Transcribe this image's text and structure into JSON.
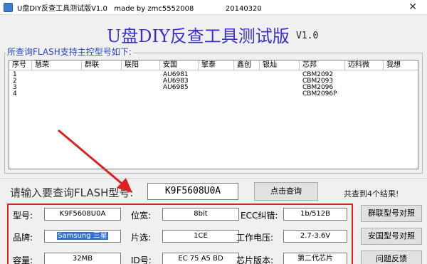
{
  "window": {
    "title": "U盘DIY反查工具测试版V1.0   made by zmc5552008              20140320",
    "close_glyph": "✕"
  },
  "banner": {
    "title": "U盘DIY反查工具测试版",
    "version": "V1.0"
  },
  "controller_group": {
    "label": "所查询FLASH支持主控型号如下:"
  },
  "table": {
    "columns": [
      "序号",
      "慧荣",
      "群联",
      "联阳",
      "安国",
      "擎泰",
      "鑫创",
      "银灿",
      "芯邦",
      "迈科微",
      "我想"
    ],
    "rows": [
      {
        "no": "1",
        "anguo": "AU6981",
        "xinbang": "CBM2092"
      },
      {
        "no": "2",
        "anguo": "AU6983",
        "xinbang": "CBM2093"
      },
      {
        "no": "3",
        "anguo": "AU6985",
        "xinbang": "CBM2096"
      },
      {
        "no": "4",
        "anguo": "",
        "xinbang": "CBM2096P"
      }
    ]
  },
  "search": {
    "prompt": "请输入要查询FLASH型号:",
    "value": "K9F5608U0A",
    "button": "点击查询",
    "result": "共查到4个结果!"
  },
  "details": {
    "model_label": "型号:",
    "model_value": "K9F5608U0A",
    "brand_label": "品牌:",
    "brand_value": "Samsung 三星",
    "capacity_label": "容量:",
    "capacity_value": "32MB",
    "width_label": "位宽:",
    "width_value": "8bit",
    "chipsel_label": "片选:",
    "chipsel_value": "1CE",
    "id_label": "ID号:",
    "id_value": "EC 75 A5 BD",
    "ecc_label": "ECC纠错:",
    "ecc_value": "1b/512B",
    "voltage_label": "工作电压:",
    "voltage_value": "2.7-3.6V",
    "chipver_label": "芯片版本:",
    "chipver_value": "第二代芯片"
  },
  "side_buttons": {
    "qunlian": "群联型号对照",
    "anguo": "安国型号对照",
    "feedback": "问题反馈"
  },
  "colors": {
    "banner_title": "#3b2fd6",
    "group_label": "#2a46d0",
    "annotation_red": "#e02020",
    "selection": "#3170d6"
  }
}
